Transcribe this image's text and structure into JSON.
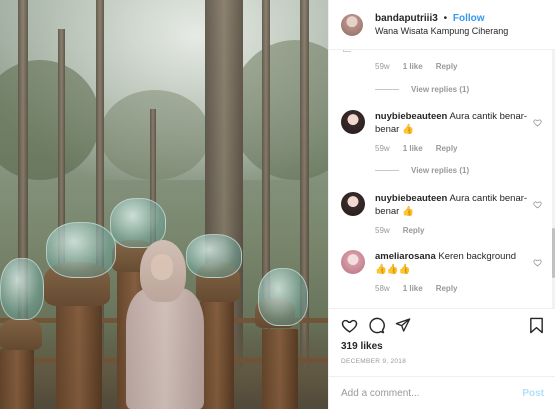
{
  "header": {
    "username": "bandaputriii3",
    "separator": "•",
    "follow_label": "Follow",
    "location": "Wana Wisata Kampung Ciherang"
  },
  "comments": [
    {
      "kind": "meta",
      "ago": "59w",
      "likes": "1 like",
      "reply": "Reply"
    },
    {
      "kind": "view_replies",
      "label": "View replies (1)"
    },
    {
      "kind": "comment",
      "username": "nuybiebeauteen",
      "text": "Aura cantik benar-benar",
      "emoji": "👍"
    },
    {
      "kind": "meta",
      "ago": "59w",
      "likes": "1 like",
      "reply": "Reply"
    },
    {
      "kind": "view_replies",
      "label": "View replies (1)"
    },
    {
      "kind": "comment",
      "username": "nuybiebeauteen",
      "text": "Aura cantik benar-benar",
      "emoji": "👍"
    },
    {
      "kind": "meta",
      "ago": "59w",
      "reply": "Reply"
    },
    {
      "kind": "comment",
      "username": "ameliarosana",
      "text": "Keren background",
      "emoji": "👍👍👍"
    },
    {
      "kind": "meta",
      "ago": "58w",
      "likes": "1 like",
      "reply": "Reply"
    }
  ],
  "actions": {
    "likes": "319 likes",
    "date": "DECEMBER 9, 2018"
  },
  "add_comment": {
    "placeholder": "Add a comment...",
    "post_label": "Post"
  },
  "colors": {
    "link": "#3897f0",
    "post_disabled": "#b2dffc",
    "muted": "#999999",
    "text": "#262626",
    "like_emoji": "#f0a92a"
  },
  "icons": [
    "heart-icon",
    "comment-icon",
    "share-icon",
    "bookmark-icon",
    "like-heart-icon"
  ]
}
